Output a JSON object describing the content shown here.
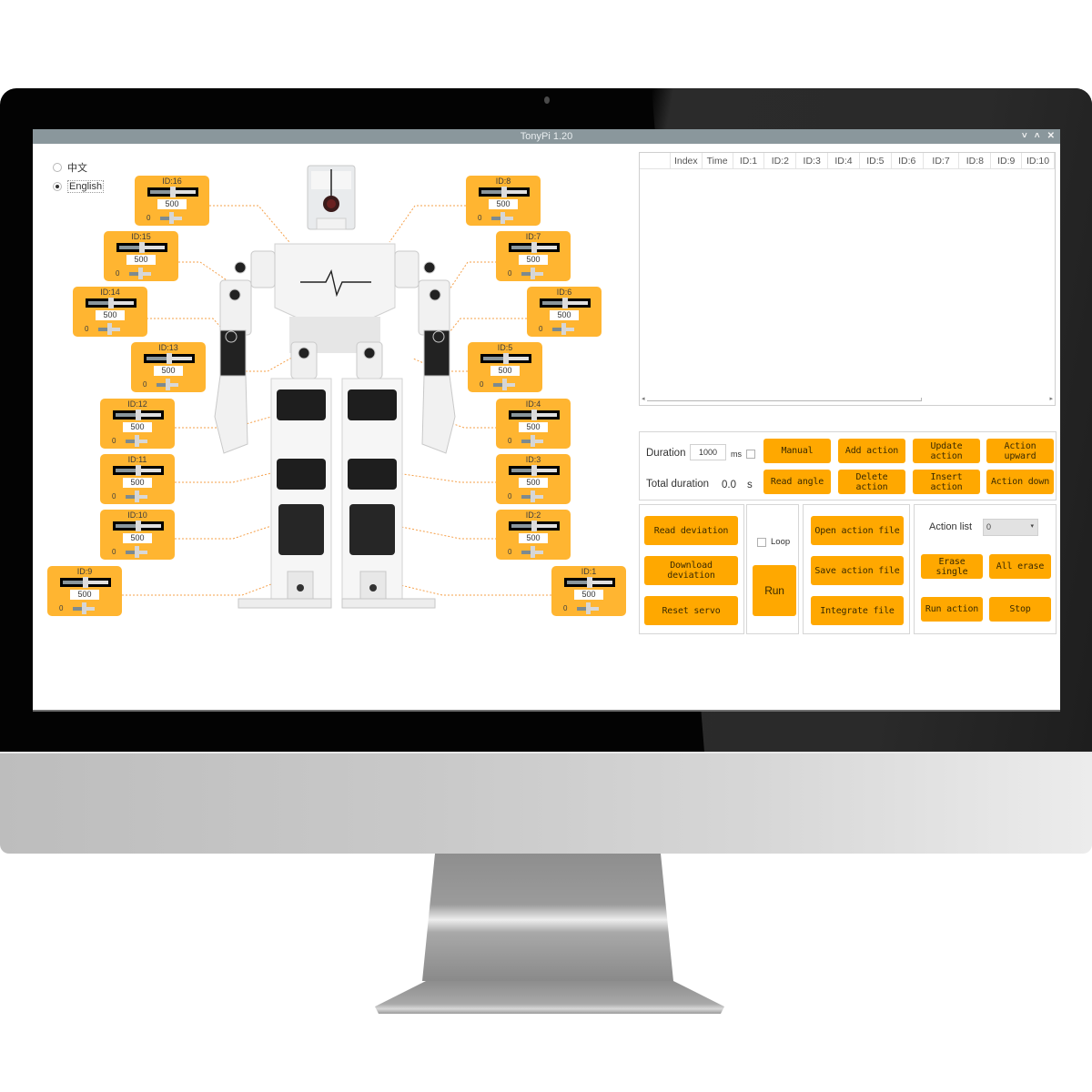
{
  "window": {
    "title": "TonyPi 1.20",
    "controls": {
      "minimize": "˅",
      "maximize": "˄",
      "close": "✕"
    }
  },
  "language": {
    "options": [
      {
        "label": "中文",
        "selected": false
      },
      {
        "label": "English",
        "selected": true
      }
    ]
  },
  "servos": [
    {
      "id_label": "ID:16",
      "value": "500",
      "min_label": "0",
      "side": "left"
    },
    {
      "id_label": "ID:15",
      "value": "500",
      "min_label": "0",
      "side": "left"
    },
    {
      "id_label": "ID:14",
      "value": "500",
      "min_label": "0",
      "side": "left"
    },
    {
      "id_label": "ID:13",
      "value": "500",
      "min_label": "0",
      "side": "left"
    },
    {
      "id_label": "ID:12",
      "value": "500",
      "min_label": "0",
      "side": "left"
    },
    {
      "id_label": "ID:11",
      "value": "500",
      "min_label": "0",
      "side": "left"
    },
    {
      "id_label": "ID:10",
      "value": "500",
      "min_label": "0",
      "side": "left"
    },
    {
      "id_label": "ID:9",
      "value": "500",
      "min_label": "0",
      "side": "left"
    },
    {
      "id_label": "ID:8",
      "value": "500",
      "min_label": "0",
      "side": "right"
    },
    {
      "id_label": "ID:7",
      "value": "500",
      "min_label": "0",
      "side": "right"
    },
    {
      "id_label": "ID:6",
      "value": "500",
      "min_label": "0",
      "side": "right"
    },
    {
      "id_label": "ID:5",
      "value": "500",
      "min_label": "0",
      "side": "right"
    },
    {
      "id_label": "ID:4",
      "value": "500",
      "min_label": "0",
      "side": "right"
    },
    {
      "id_label": "ID:3",
      "value": "500",
      "min_label": "0",
      "side": "right"
    },
    {
      "id_label": "ID:2",
      "value": "500",
      "min_label": "0",
      "side": "right"
    },
    {
      "id_label": "ID:1",
      "value": "500",
      "min_label": "0",
      "side": "right"
    }
  ],
  "action_table": {
    "columns": [
      "",
      "Index",
      "Time",
      "ID:1",
      "ID:2",
      "ID:3",
      "ID:4",
      "ID:5",
      "ID:6",
      "ID:7",
      "ID:8",
      "ID:9",
      "ID:10"
    ],
    "rows": []
  },
  "timing": {
    "duration_label": "Duration",
    "duration_value": "1000",
    "duration_unit": "ms",
    "total_label": "Total duration",
    "total_value": "0.0",
    "total_unit": "s"
  },
  "edit_buttons": {
    "manual": "Manual",
    "add_action": "Add action",
    "update_action": "Update action",
    "action_upward": "Action upward",
    "read_angle": "Read angle",
    "delete_action": "Delete action",
    "insert_action": "Insert action",
    "action_down": "Action down"
  },
  "deviation": {
    "read": "Read deviation",
    "download": "Download deviation",
    "reset": "Reset servo"
  },
  "run_panel": {
    "loop_label": "Loop",
    "loop_checked": false,
    "run": "Run"
  },
  "file_panel": {
    "open": "Open action file",
    "save": "Save action file",
    "integrate": "Integrate file"
  },
  "action_list_panel": {
    "label": "Action list",
    "selected": "0",
    "erase_single": "Erase single",
    "all_erase": "All erase",
    "run_action": "Run action",
    "stop": "Stop"
  },
  "colors": {
    "button": "#ffa800",
    "servo_panel": "#ffb531",
    "titlebar": "#8a979c",
    "leader_line": "#f5a04a"
  }
}
